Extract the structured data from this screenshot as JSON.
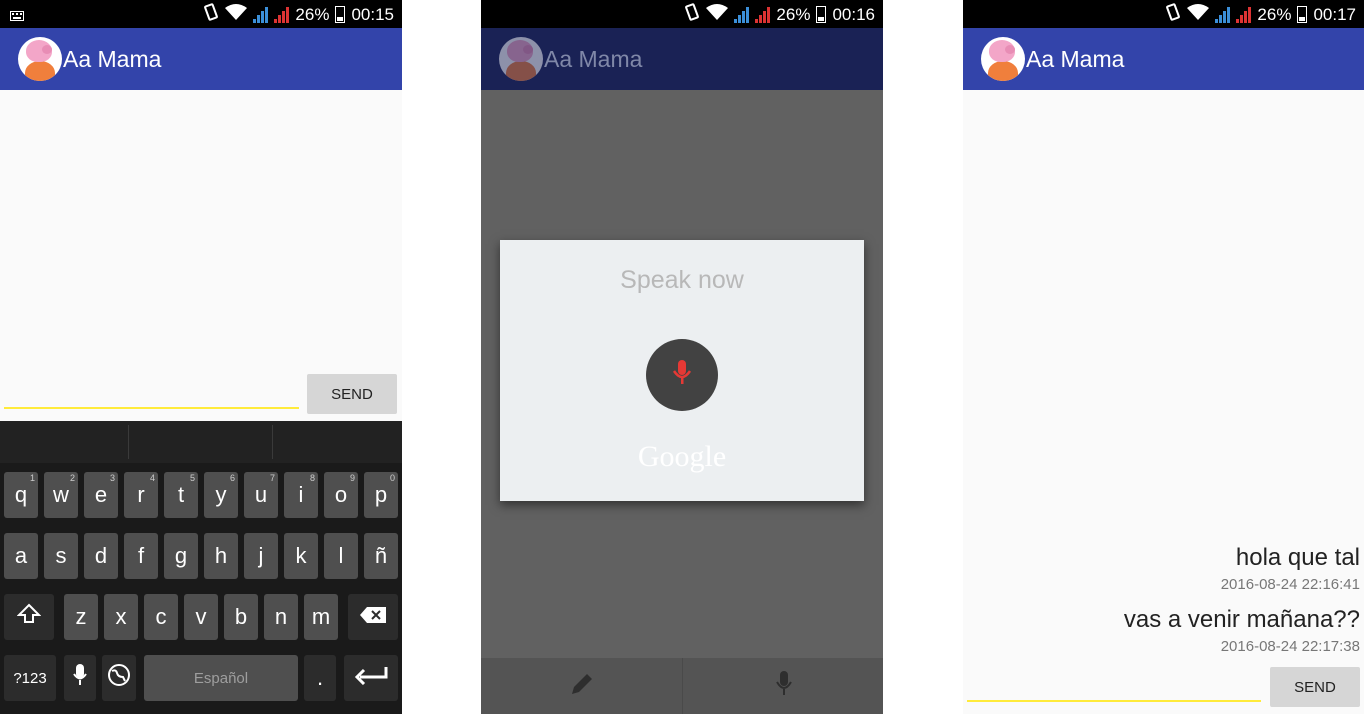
{
  "status": {
    "battery_percent": "26%",
    "times": [
      "00:15",
      "00:16",
      "00:17"
    ]
  },
  "app": {
    "title": "Aa Mama"
  },
  "composer": {
    "send_label": "SEND"
  },
  "keyboard": {
    "row1": [
      {
        "key": "q",
        "hint": "1"
      },
      {
        "key": "w",
        "hint": "2"
      },
      {
        "key": "e",
        "hint": "3"
      },
      {
        "key": "r",
        "hint": "4"
      },
      {
        "key": "t",
        "hint": "5"
      },
      {
        "key": "y",
        "hint": "6"
      },
      {
        "key": "u",
        "hint": "7"
      },
      {
        "key": "i",
        "hint": "8"
      },
      {
        "key": "o",
        "hint": "9"
      },
      {
        "key": "p",
        "hint": "0"
      }
    ],
    "row2": [
      "a",
      "s",
      "d",
      "f",
      "g",
      "h",
      "j",
      "k",
      "l",
      "ñ"
    ],
    "row3": [
      "z",
      "x",
      "c",
      "v",
      "b",
      "n",
      "m"
    ],
    "symbols_label": "?123",
    "space_label": "Español",
    "period_label": "."
  },
  "voice": {
    "prompt": "Speak now",
    "brand": "Google",
    "accent": "#e53935"
  },
  "messages": [
    {
      "text": "hola que tal",
      "time": "2016-08-24 22:16:41"
    },
    {
      "text": "vas a venir mañana??",
      "time": "2016-08-24 22:17:38"
    }
  ]
}
